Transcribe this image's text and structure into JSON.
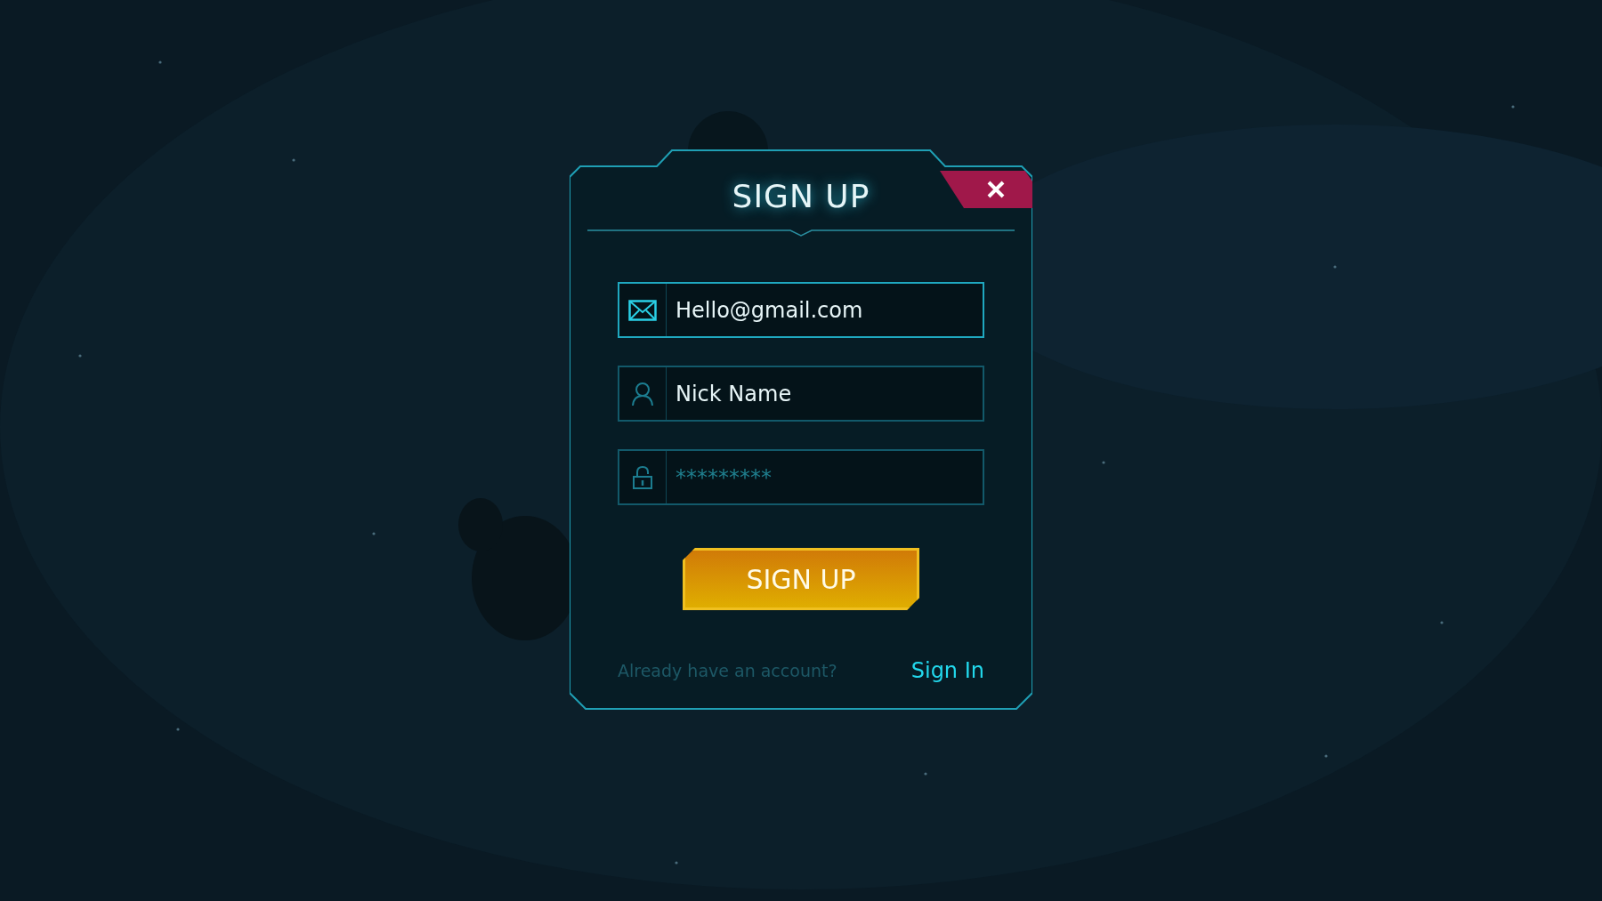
{
  "dialog": {
    "title": "SIGN UP",
    "fields": [
      {
        "kind": "email",
        "value": "Hello@gmail.com",
        "focused": true
      },
      {
        "kind": "name",
        "value": "Nick Name",
        "focused": false
      },
      {
        "kind": "password",
        "placeholder": "*********",
        "focused": false
      }
    ],
    "submit": "SIGN UP",
    "footer": {
      "prompt": "Already have an account?",
      "link": "Sign In"
    }
  }
}
